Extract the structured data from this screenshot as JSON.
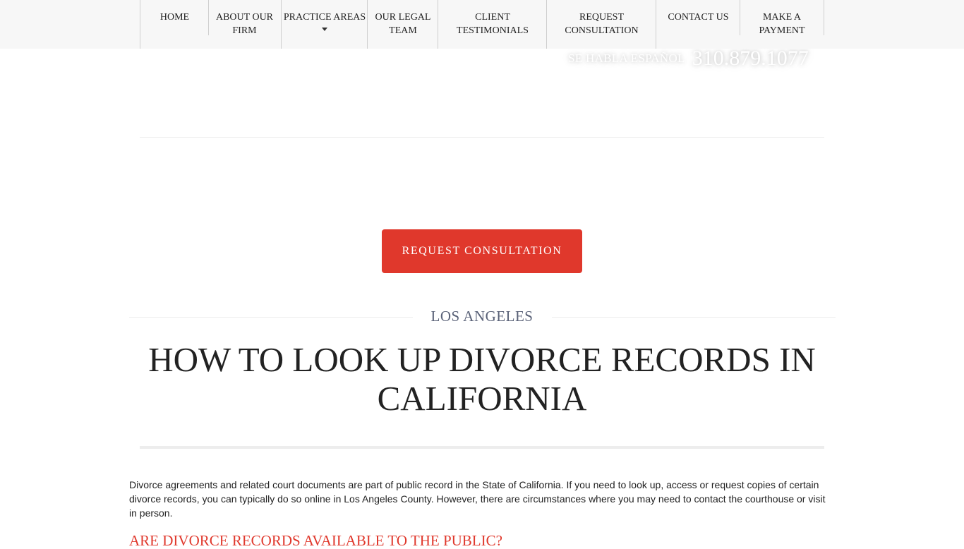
{
  "nav": {
    "items": [
      {
        "label": "HOME"
      },
      {
        "label": "ABOUT OUR FIRM"
      },
      {
        "label": "PRACTICE AREAS"
      },
      {
        "label": "OUR LEGAL TEAM"
      },
      {
        "label": "CLIENT TESTIMONIALS"
      },
      {
        "label": "REQUEST CONSULTATION"
      },
      {
        "label": "CONTACT US"
      },
      {
        "label": "MAKE A PAYMENT"
      }
    ],
    "dropdown_icon": "caret-down-icon"
  },
  "header": {
    "spanish": "SE HABLA ESPAÑOL",
    "phone": "310.879.1077"
  },
  "cta": {
    "label": "REQUEST CONSULTATION"
  },
  "page": {
    "location": "LOS ANGELES",
    "title": "HOW TO LOOK UP DIVORCE RECORDS IN CALIFORNIA"
  },
  "article": {
    "intro": "Divorce agreements and related court documents are part of public record in the State of California. If you need to look up, access or request copies of certain divorce records, you can typically do so online in Los Angeles County. However, there are circumstances where you may need to contact the courthouse or visit in person.",
    "subheading": "ARE DIVORCE RECORDS AVAILABLE TO THE PUBLIC?"
  },
  "colors": {
    "accent_red": "#e0382c",
    "nav_bg": "#f7f7f7",
    "location_text": "#5a6278",
    "body_text": "#222222"
  }
}
